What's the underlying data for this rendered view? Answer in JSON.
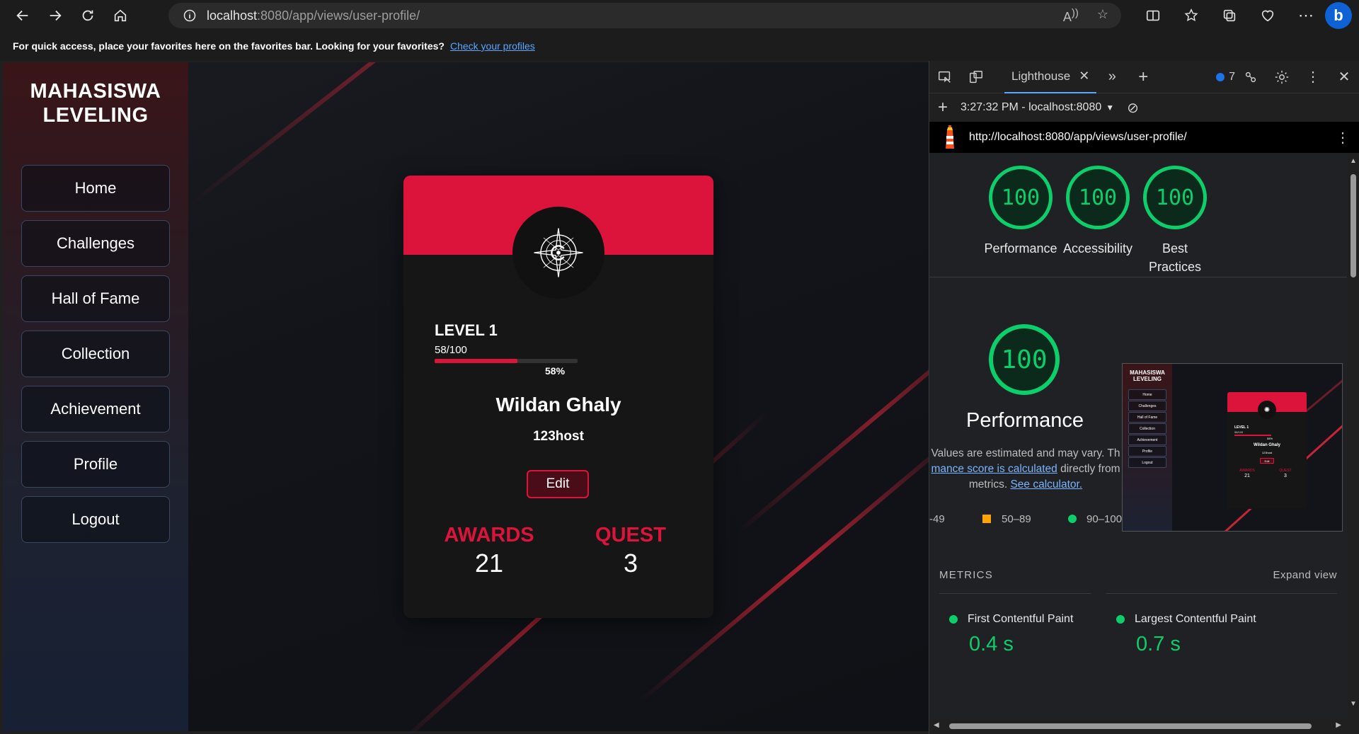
{
  "browser": {
    "url_host": "localhost",
    "url_rest": ":8080/app/views/user-profile/",
    "favbar_text": "For quick access, place your favorites here on the favorites bar. Looking for your favorites?",
    "favbar_link": "Check your profiles"
  },
  "app": {
    "brand_line1": "MAHASISWA",
    "brand_line2": "LEVELING",
    "nav": [
      "Home",
      "Challenges",
      "Hall of Fame",
      "Collection",
      "Achievement",
      "Profile",
      "Logout"
    ],
    "profile": {
      "level": "LEVEL 1",
      "xp": "58/100",
      "progress_fraction": 0.58,
      "progress_label": "58%",
      "name": "Wildan Ghaly",
      "handle": "123host",
      "edit_label": "Edit",
      "awards_label": "AWARDS",
      "awards_value": "21",
      "quest_label": "QUEST",
      "quest_value": "3"
    },
    "accent_color": "#dc143c"
  },
  "devtools": {
    "tab_label": "Lighthouse",
    "issues_count": "7",
    "report_time": "3:27:32 PM - localhost:8080",
    "report_url": "http://localhost:8080/app/views/user-profile/",
    "scores": [
      {
        "value": "100",
        "label": "Performance"
      },
      {
        "value": "100",
        "label": "Accessibility"
      },
      {
        "value": "100",
        "label": "Best Practices"
      }
    ],
    "perf_score": "100",
    "perf_title": "Performance",
    "desc_line1": "Values are estimated and may vary. Th",
    "desc_link1": "mance score is calculated",
    "desc_line2_rest": " directly from",
    "desc_line3": "metrics. ",
    "desc_link2": "See calculator.",
    "legend_low": "-49",
    "legend_mid": "50–89",
    "legend_high": "90–100",
    "metrics_label": "METRICS",
    "expand_label": "Expand view",
    "metrics": [
      {
        "name": "First Contentful Paint",
        "value": "0.4 s"
      },
      {
        "name": "Largest Contentful Paint",
        "value": "0.7 s"
      }
    ],
    "thumb": {
      "brand": "MAHASISWA LEVELING",
      "nav": [
        "Home",
        "Challenges",
        "Hall of Fame",
        "Collection",
        "Achievement",
        "Profile",
        "Logout"
      ],
      "level": "LEVEL 1",
      "name": "Wildan Ghaly",
      "handle": "123host",
      "edit": "Edit",
      "awards": "AWARDS",
      "awards_value": "21",
      "quest": "QUEST",
      "quest_value": "3",
      "pct": "58%",
      "xp": "58/100"
    },
    "good_color": "#0cce6b",
    "avg_color": "#ffa400"
  }
}
